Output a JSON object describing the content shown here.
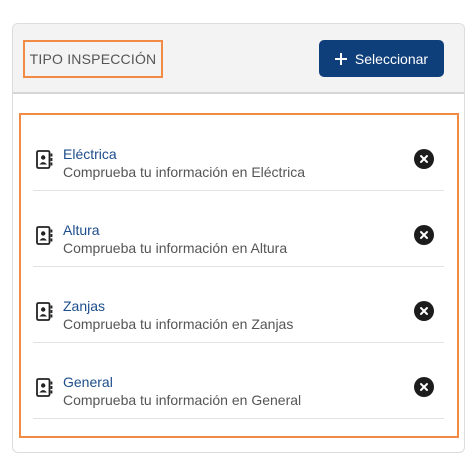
{
  "header": {
    "title": "TIPO INSPECCIÓN",
    "select_label": "Seleccionar"
  },
  "items": [
    {
      "title": "Eléctrica",
      "description": "Comprueba tu información en Eléctrica"
    },
    {
      "title": "Altura",
      "description": "Comprueba tu información en Altura"
    },
    {
      "title": "Zanjas",
      "description": "Comprueba tu información en Zanjas"
    },
    {
      "title": "General",
      "description": "Comprueba tu información en General"
    }
  ],
  "icons": {
    "item": "contact-card-icon",
    "remove": "close-circle-icon",
    "add": "plus-icon"
  },
  "colors": {
    "primary_button": "#0f3f7a",
    "link_text": "#1d4d8c",
    "highlight_border": "#f08a45"
  }
}
